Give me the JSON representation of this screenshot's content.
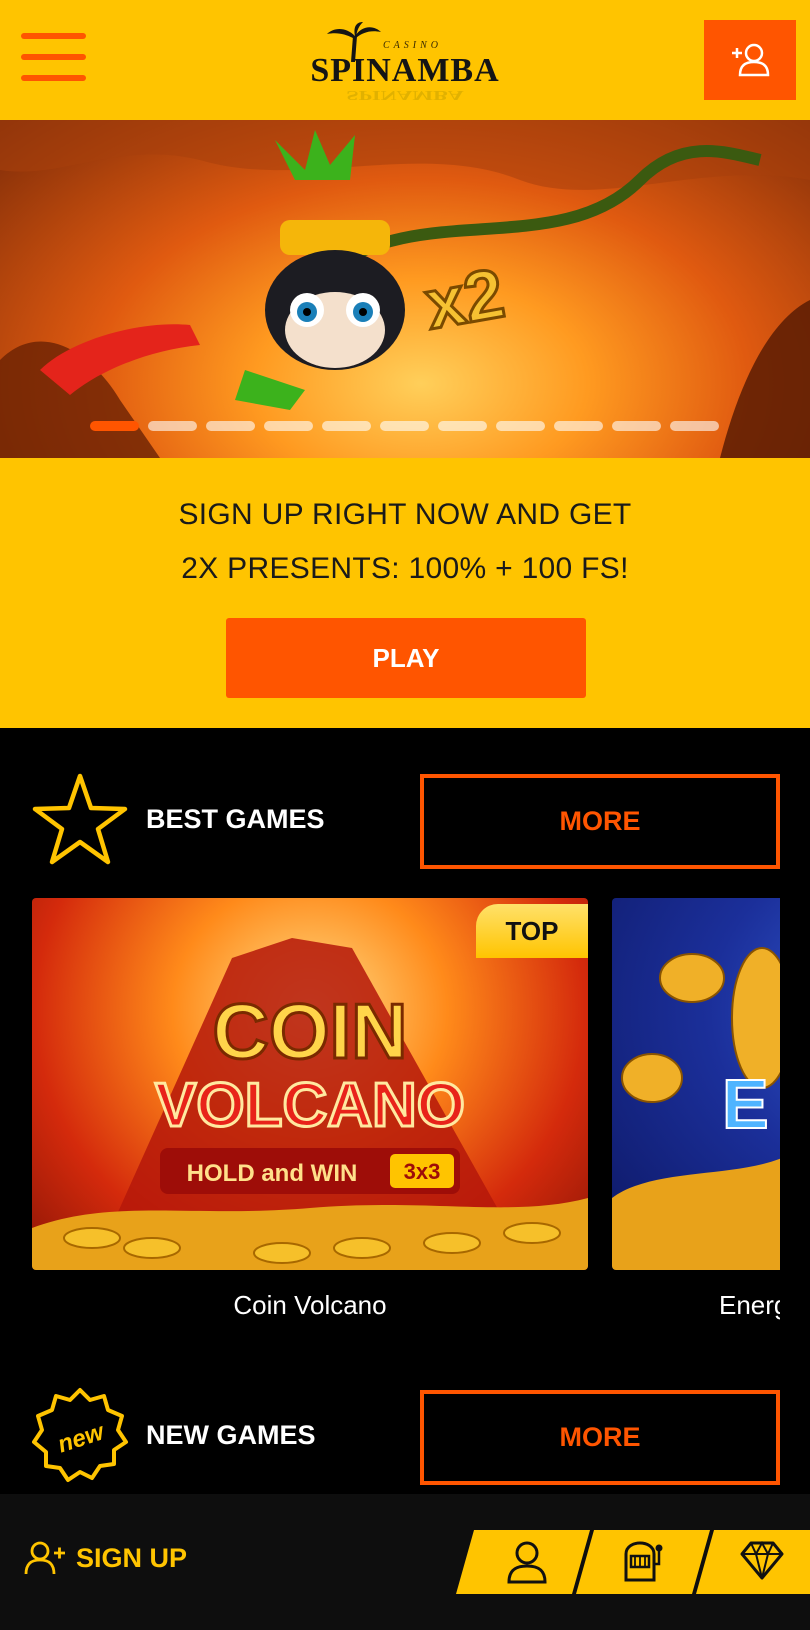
{
  "header": {
    "logo_tag": "CASINO",
    "logo_word": "SPINAMBA",
    "menu_icon": "hamburger-menu-icon",
    "user_icon": "add-user-icon"
  },
  "banner": {
    "slide_count": 11,
    "active_slide": 1,
    "multiplier_text": "x2"
  },
  "promo": {
    "line1": "SIGN UP RIGHT NOW AND GET",
    "line2": "2X PRESENTS: 100% + 100 FS!",
    "play_label": "PLAY"
  },
  "best_games": {
    "title": "BEST GAMES",
    "more_label": "MORE",
    "icon": "star-icon",
    "items": [
      {
        "name": "Coin Volcano",
        "badge": "TOP",
        "art_line1": "COIN",
        "art_line2": "VOLCANO",
        "art_line3": "HOLD and WIN",
        "art_tag": "3x3"
      },
      {
        "name": "Energ",
        "art_text": "E"
      }
    ]
  },
  "new_games": {
    "title": "NEW GAMES",
    "more_label": "MORE",
    "icon": "new-badge-icon",
    "icon_text": "new"
  },
  "bottom_bar": {
    "signup_label": "SIGN UP",
    "tabs": [
      "profile-icon",
      "slot-machine-icon",
      "diamond-icon"
    ]
  },
  "colors": {
    "brand_yellow": "#ffc400",
    "brand_orange": "#ff5500",
    "background": "#000000"
  }
}
